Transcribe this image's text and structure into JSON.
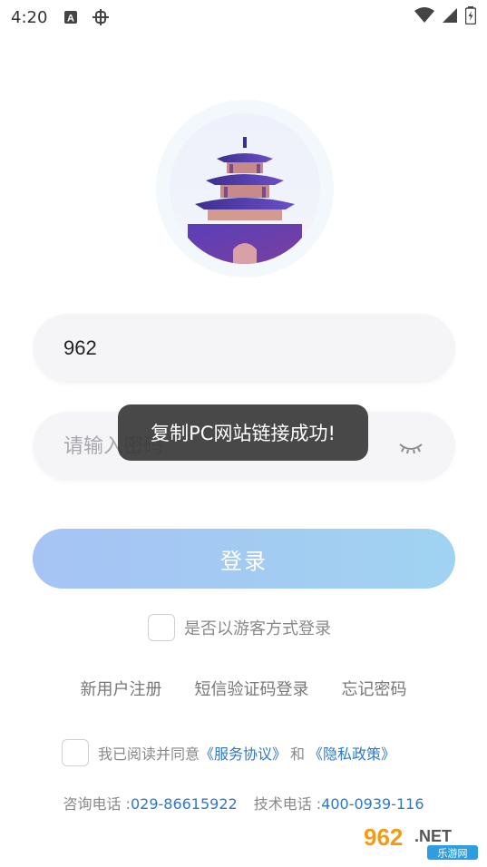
{
  "status_bar": {
    "time": "4:20",
    "icons": [
      "a-icon",
      "bug-icon",
      "wifi-icon",
      "signal-icon",
      "battery-icon"
    ]
  },
  "login": {
    "username_value": "962",
    "password_placeholder": "请输入密码",
    "login_button": "登录",
    "guest_label": "是否以游客方式登录"
  },
  "links": {
    "register": "新用户注册",
    "sms_login": "短信验证码登录",
    "forgot": "忘记密码"
  },
  "agreement": {
    "prefix": "我已阅读并同意",
    "service": "《服务协议》",
    "and": "和",
    "privacy": "《隐私政策》"
  },
  "contact": {
    "consult_label": "咨询电话 :",
    "consult_number": "029-86615922",
    "tech_label": "技术电话 :",
    "tech_number": "400-0939-116"
  },
  "toast": {
    "message": "复制PC网站链接成功!"
  },
  "watermark": {
    "text": "962.NET",
    "subtext": "乐游网"
  },
  "colors": {
    "accent_blue": "#2f78c9",
    "button_gradient_start": "#a6c3f4",
    "button_gradient_end": "#a0d3f1",
    "logo_purple": "#4b3aa3"
  }
}
